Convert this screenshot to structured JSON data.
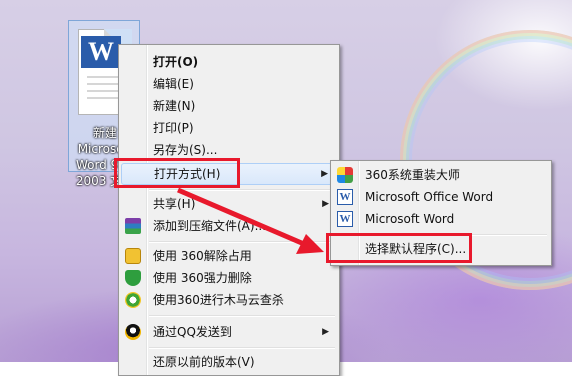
{
  "desktop_icon": {
    "label": "新建 Microsoft Word 97 - 2003 文档"
  },
  "context_menu": {
    "items": [
      {
        "label": "打开(O)"
      },
      {
        "label": "编辑(E)"
      },
      {
        "label": "新建(N)"
      },
      {
        "label": "打印(P)"
      },
      {
        "label": "另存为(S)..."
      },
      {
        "label": "打开方式(H)"
      },
      {
        "label": "共享(H)"
      },
      {
        "label": "添加到压缩文件(A)..."
      },
      {
        "label": "使用 360解除占用"
      },
      {
        "label": "使用 360强力删除"
      },
      {
        "label": "使用360进行木马云查杀"
      },
      {
        "label": "通过QQ发送到"
      },
      {
        "label": "还原以前的版本(V)"
      }
    ],
    "submenu_arrow": "▶"
  },
  "open_with_submenu": {
    "items": [
      {
        "label": "360系统重装大师",
        "icon": "360-reinstall-icon"
      },
      {
        "label": "Microsoft Office Word",
        "icon": "word-icon"
      },
      {
        "label": "Microsoft Word",
        "icon": "word-icon"
      },
      {
        "label": "选择默认程序(C)..."
      }
    ]
  },
  "annotation": {
    "color": "#e8192c"
  }
}
